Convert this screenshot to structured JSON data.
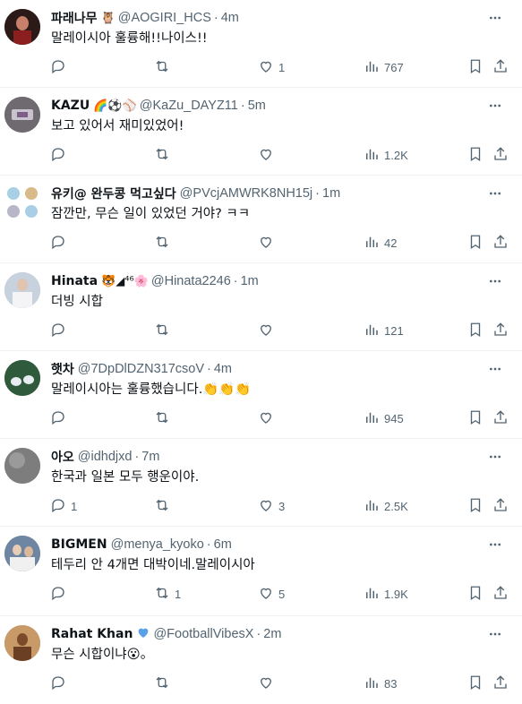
{
  "tweets": [
    {
      "name": "파래나무",
      "emoji": "🦉",
      "handle": "@AOGIRI_HCS",
      "time": "4m",
      "text": "말레이시아 훌륭해!!나이스!!",
      "reply_count": "",
      "retweet_count": "",
      "like_count": "1",
      "view_count": "767",
      "avatar_color": "#5a2a1e"
    },
    {
      "name": "KAZU",
      "emoji": "🌈⚽⚾",
      "handle": "@KaZu_DAYZ11",
      "time": "5m",
      "text": "보고 있어서 재미있었어!",
      "reply_count": "",
      "retweet_count": "",
      "like_count": "",
      "view_count": "1.2K",
      "avatar_color": "#7a6f74"
    },
    {
      "name": "유키@ 완두콩 먹고싶다",
      "emoji": "",
      "handle": "@PVcjAMWRK8NH15j",
      "time": "1m",
      "text": "잠깐만, 무슨 일이 있었던 거야? ㅋㅋ",
      "reply_count": "",
      "retweet_count": "",
      "like_count": "",
      "view_count": "42",
      "avatar_color": "#cfe3ef"
    },
    {
      "name": "Hinata",
      "emoji": "🐯◢⁴⁶🌸",
      "handle": "@Hinata2246",
      "time": "1m",
      "text": "더빙 시합",
      "reply_count": "",
      "retweet_count": "",
      "like_count": "",
      "view_count": "121",
      "avatar_color": "#9aa6b8"
    },
    {
      "name": "햇차",
      "emoji": "",
      "handle": "@7DpDlDZN317csoV",
      "time": "4m",
      "text": "말레이시아는 훌륭했습니다.",
      "text_suffix": "👏👏👏",
      "reply_count": "",
      "retweet_count": "",
      "like_count": "",
      "view_count": "945",
      "avatar_color": "#3d6b4a"
    },
    {
      "name": "아오",
      "emoji": "",
      "handle": "@idhdjxd",
      "time": "7m",
      "text": "한국과 일본 모두 행운이야.",
      "reply_count": "1",
      "retweet_count": "",
      "like_count": "3",
      "view_count": "2.5K",
      "avatar_color": "#8c8c8c"
    },
    {
      "name": "BIGMEN",
      "emoji": "",
      "handle": "@menya_kyoko",
      "time": "6m",
      "text": "테두리 안 4개면 대박이네.말레이시아",
      "reply_count": "",
      "retweet_count": "1",
      "like_count": "5",
      "view_count": "1.9K",
      "avatar_color": "#7a8fa8"
    },
    {
      "name": "Rahat Khan",
      "emoji": "💙",
      "handle": "@FootballVibesX",
      "time": "2m",
      "text": "무슨 시합이냐",
      "text_suffix": "😮。",
      "reply_count": "",
      "retweet_count": "",
      "like_count": "",
      "view_count": "83",
      "avatar_color": "#b88a5a"
    }
  ],
  "separator": "·",
  "icons": {
    "more": "more-dots-icon",
    "reply": "reply-icon",
    "retweet": "retweet-icon",
    "like": "heart-icon",
    "views": "views-chart-icon",
    "bookmark": "bookmark-icon",
    "share": "share-icon"
  },
  "colors": {
    "text": "#0f1419",
    "muted": "#536471",
    "border": "#eff3f4"
  }
}
